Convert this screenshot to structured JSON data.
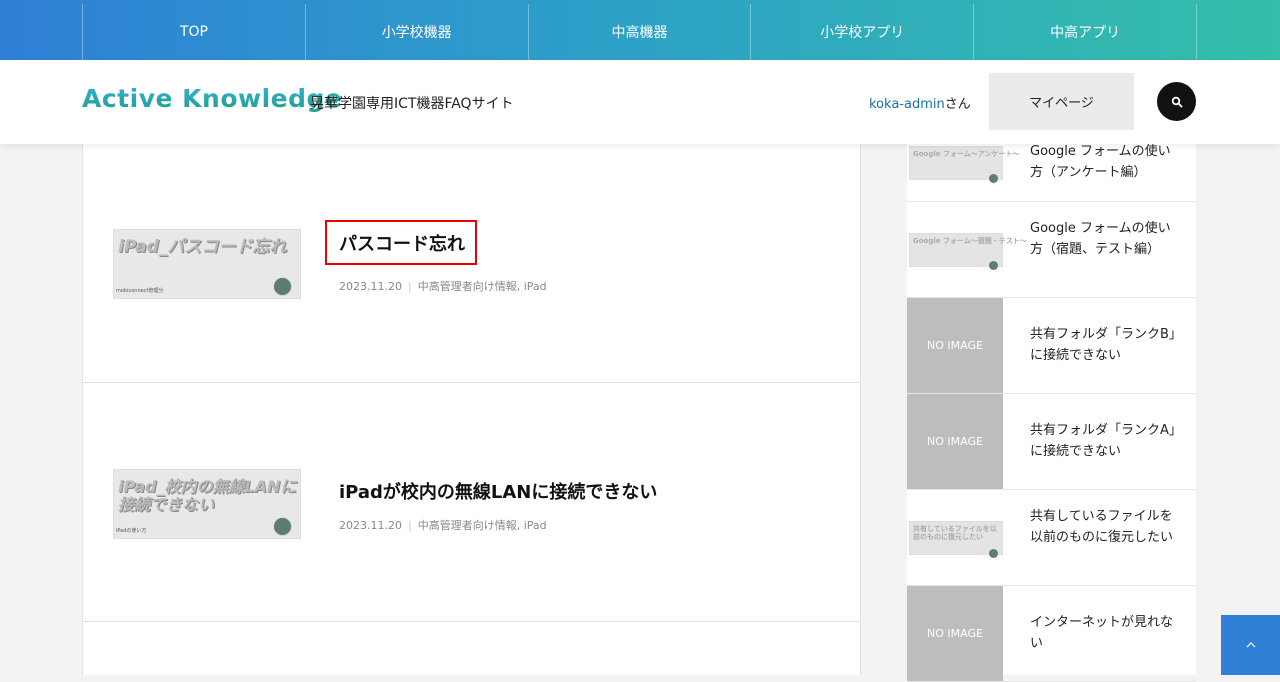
{
  "nav": {
    "items": [
      "TOP",
      "小学校機器",
      "中高機器",
      "小学校アプリ",
      "中高アプリ"
    ]
  },
  "header": {
    "logo": "Active Knowledge",
    "tagline": "晃華学園専用ICT機器FAQサイト",
    "user_name": "koka-admin",
    "user_suffix": "さん",
    "mypage_label": "マイページ",
    "search_icon": "search-icon"
  },
  "posts": [
    {
      "title": "パスコード忘れ",
      "date": "2023.11.20",
      "categories": "中高管理者向け情報, iPad",
      "thumb_text": "iPad_パスコード忘れ",
      "thumb_caption": "mobiconnect管理分"
    },
    {
      "title": "iPadが校内の無線LANに接続できない",
      "date": "2023.11.20",
      "categories": "中高管理者向け情報, iPad",
      "thumb_text": "iPad_校内の無線LANに接続できない",
      "thumb_caption": "iPadの使い方"
    }
  ],
  "sidebar": {
    "items": [
      {
        "title": "Google フォームの使い方（アンケート編）",
        "thumb": "Google フォーム〜アンケート〜"
      },
      {
        "title": "Google フォームの使い方（宿題、テスト編）",
        "thumb": "Google フォーム〜宿題・テスト〜"
      },
      {
        "title": "共有フォルダ「ランクB」に接続できない",
        "thumb": "NO IMAGE"
      },
      {
        "title": "共有フォルダ「ランクA」に接続できない",
        "thumb": "NO IMAGE"
      },
      {
        "title": "共有しているファイルを以前のものに復元したい",
        "thumb": "共有しているファイルを以前のものに復元したい"
      },
      {
        "title": "インターネットが見れない",
        "thumb": "NO IMAGE"
      }
    ]
  },
  "totop": {
    "icon": "chevron-up-icon",
    "label": "^"
  },
  "colors": {
    "nav_start": "#2f80d6",
    "nav_end": "#33bfa9",
    "highlight": "#e00000",
    "link": "#1a6fb0"
  }
}
